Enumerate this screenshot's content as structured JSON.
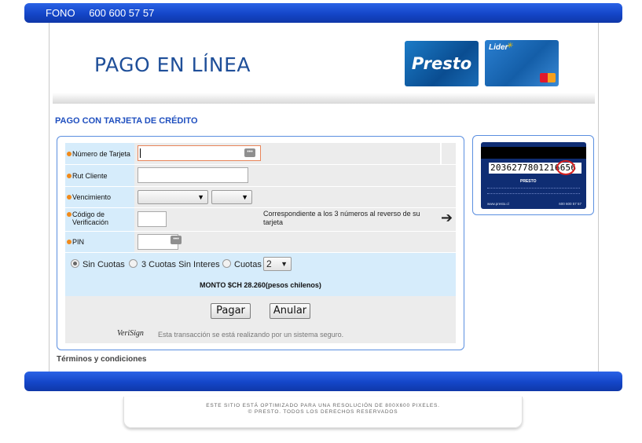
{
  "header": {
    "phone_label": "FONO",
    "phone_number": "600 600 57 57"
  },
  "banner": {
    "title": "PAGO EN LÍNEA",
    "card1_label": "Presto",
    "card2_label": "Lider"
  },
  "section_title": "PAGO CON TARJETA DE CRÉDITO",
  "form": {
    "card_number_label": "Número de Tarjeta",
    "card_number_value": "",
    "rut_label": "Rut Cliente",
    "rut_value": "",
    "expiry_label": "Vencimiento",
    "expiry_month": "",
    "expiry_year": "",
    "cvv_label": "Código de Verificación",
    "cvv_value": "",
    "cvv_hint": "Correspondiente a los 3 números al reverso de su tarjeta",
    "pin_label": "PIN",
    "pin_value": "",
    "option_sin_cuotas": "Sin Cuotas",
    "option_3_cuotas": "3 Cuotas Sin Interes",
    "option_cuotas": "Cuotas",
    "cuotas_selected": "2",
    "amount": "MONTO $CH  28.260(pesos chilenos)",
    "pay_button": "Pagar",
    "cancel_button": "Anular",
    "verisign_text": "Esta transacción se está realizando por un sistema seguro.",
    "verisign_logo": "VeriSign"
  },
  "card_back": {
    "number": "2036277801216",
    "cvv": "656",
    "logo": "PRESTO",
    "site": "www.presto.cl",
    "phone": "600 600 57 57"
  },
  "terms_link": "Términos y condiciones",
  "footer": {
    "line1": "ESTE SITIO ESTÁ OPTIMIZADO PARA UNA RESOLUCIÓN DE 800X600 PIXELES.",
    "line2": "© PRESTO. TODOS LOS DERECHOS RESERVADOS"
  }
}
